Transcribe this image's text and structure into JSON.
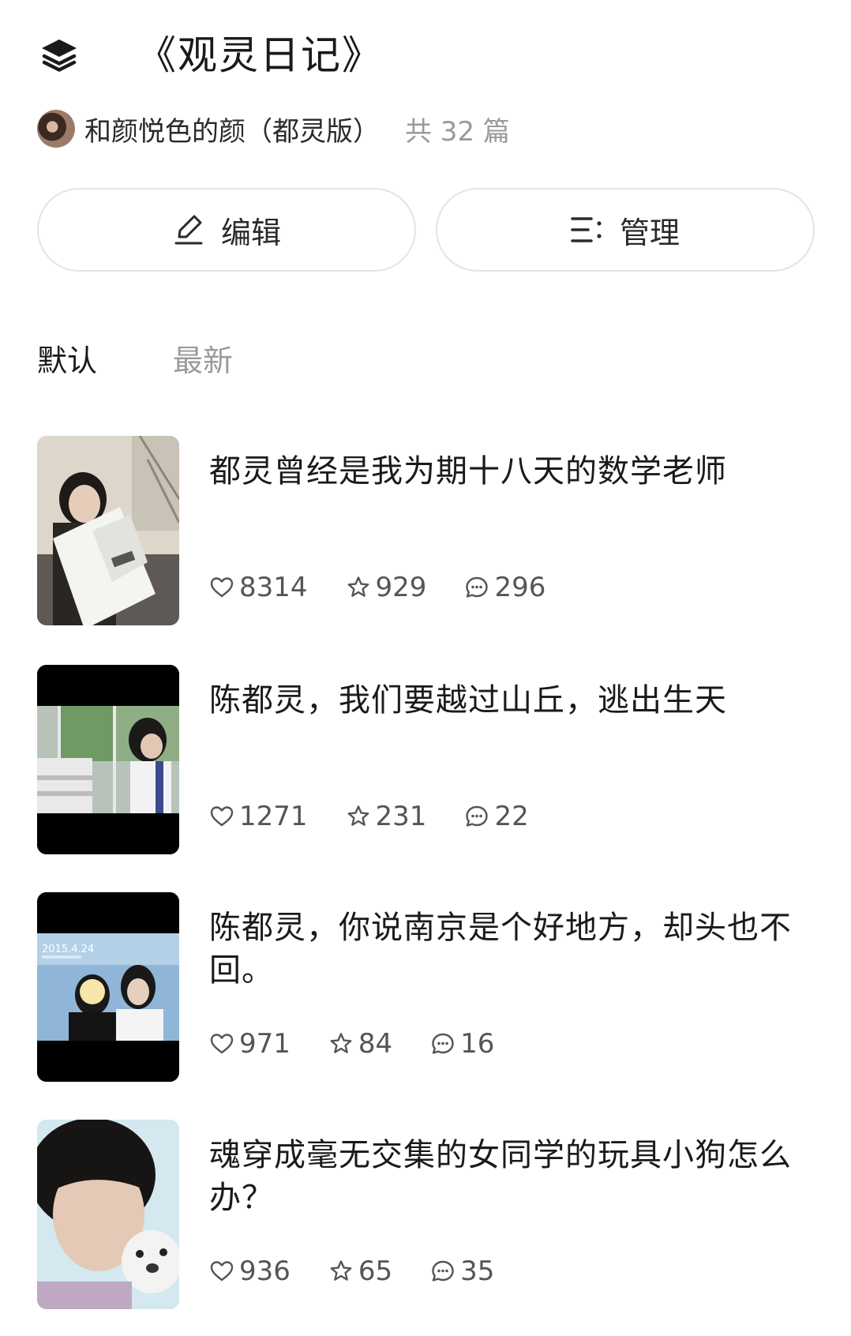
{
  "header": {
    "title": "《观灵日记》",
    "icon": "layers-icon"
  },
  "author": {
    "name": "和颜悦色的颜（都灵版）",
    "count": "共 32 篇"
  },
  "actions": {
    "edit_label": "编辑",
    "manage_label": "管理"
  },
  "tabs": {
    "default": "默认",
    "latest": "最新"
  },
  "articles": [
    {
      "title": "都灵曾经是我为期十八天的数学老师",
      "likes": "8314",
      "favorites": "929",
      "comments": "296"
    },
    {
      "title": "陈都灵，我们要越过山丘，逃出生天",
      "likes": "1271",
      "favorites": "231",
      "comments": "22"
    },
    {
      "title": "陈都灵，你说南京是个好地方，却头也不回。",
      "likes": "971",
      "favorites": "84",
      "comments": "16"
    },
    {
      "title": "魂穿成毫无交集的女同学的玩具小狗怎么办？",
      "likes": "936",
      "favorites": "65",
      "comments": "35"
    }
  ],
  "thumb_text": {
    "date": "2015.4.24"
  },
  "colors": {
    "text_primary": "#1a1a1a",
    "text_secondary": "#9a9a9a",
    "border": "#e4e4e4"
  }
}
